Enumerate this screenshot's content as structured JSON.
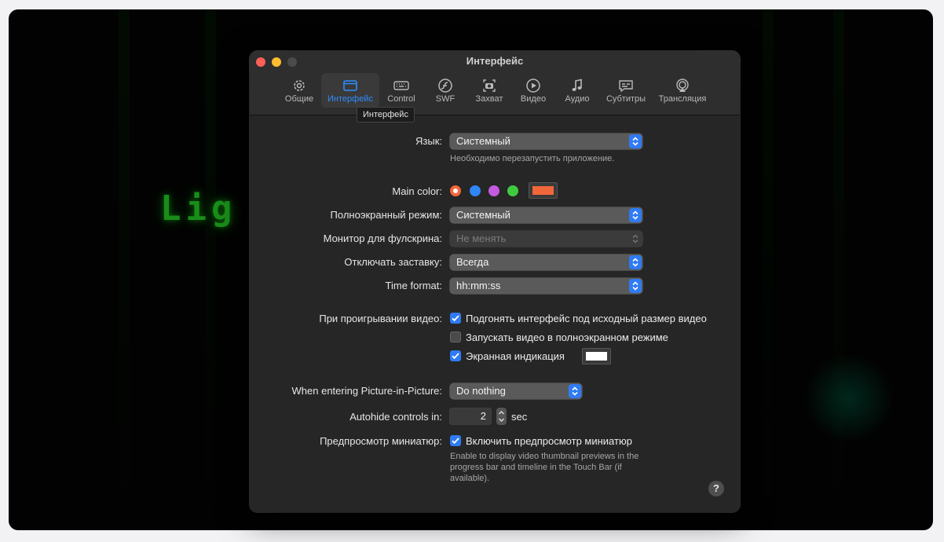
{
  "background": {
    "matrix_text": "Lig"
  },
  "window": {
    "title": "Интерфейс",
    "tooltip": "Интерфейс",
    "tabs": [
      {
        "label": "Общие",
        "icon": "gear-icon"
      },
      {
        "label": "Интерфейс",
        "icon": "window-icon",
        "active": true
      },
      {
        "label": "Control",
        "icon": "keyboard-icon"
      },
      {
        "label": "SWF",
        "icon": "flash-icon"
      },
      {
        "label": "Захват",
        "icon": "camera-icon"
      },
      {
        "label": "Видео",
        "icon": "play-icon"
      },
      {
        "label": "Аудио",
        "icon": "music-note-icon"
      },
      {
        "label": "Субтитры",
        "icon": "subtitles-icon"
      },
      {
        "label": "Трансляция",
        "icon": "airplay-icon"
      }
    ]
  },
  "settings": {
    "language": {
      "label": "Язык:",
      "value": "Системный",
      "hint": "Необходимо перезапустить приложение."
    },
    "main_color": {
      "label": "Main color:",
      "colors": [
        "#f2673a",
        "#2f86f6",
        "#c45ae0",
        "#3fcb3f"
      ],
      "selected": "#f2673a",
      "custom": "#f2673a"
    },
    "fullscreen": {
      "label": "Полноэкранный режим:",
      "value": "Системный"
    },
    "fullscreen_monitor": {
      "label": "Монитор для фулскрина:",
      "value": "Не менять"
    },
    "screensaver": {
      "label": "Отключать заставку:",
      "value": "Всегда"
    },
    "time_format": {
      "label": "Time format:",
      "value": "hh:mm:ss"
    },
    "on_play": {
      "label": "При проигрывании видео:",
      "fit_interface": {
        "label": "Подгонять интерфейс под исходный размер видео",
        "checked": true
      },
      "start_fullscreen": {
        "label": "Запускать видео в полноэкранном режиме",
        "checked": false
      },
      "osd": {
        "label": "Экранная индикация",
        "checked": true,
        "color": "#ffffff"
      }
    },
    "pip": {
      "label": "When entering Picture-in-Picture:",
      "value": "Do nothing"
    },
    "autohide": {
      "label": "Autohide controls in:",
      "value": "2",
      "unit": "sec"
    },
    "thumbnails": {
      "label": "Предпросмотр миниатюр:",
      "checkbox_label": "Включить предпросмотр миниатюр",
      "checked": true,
      "hint_lines": [
        "Enable to display video thumbnail previews in the",
        "progress bar and timeline in the Touch Bar (if",
        "available)."
      ]
    },
    "help": "?"
  }
}
